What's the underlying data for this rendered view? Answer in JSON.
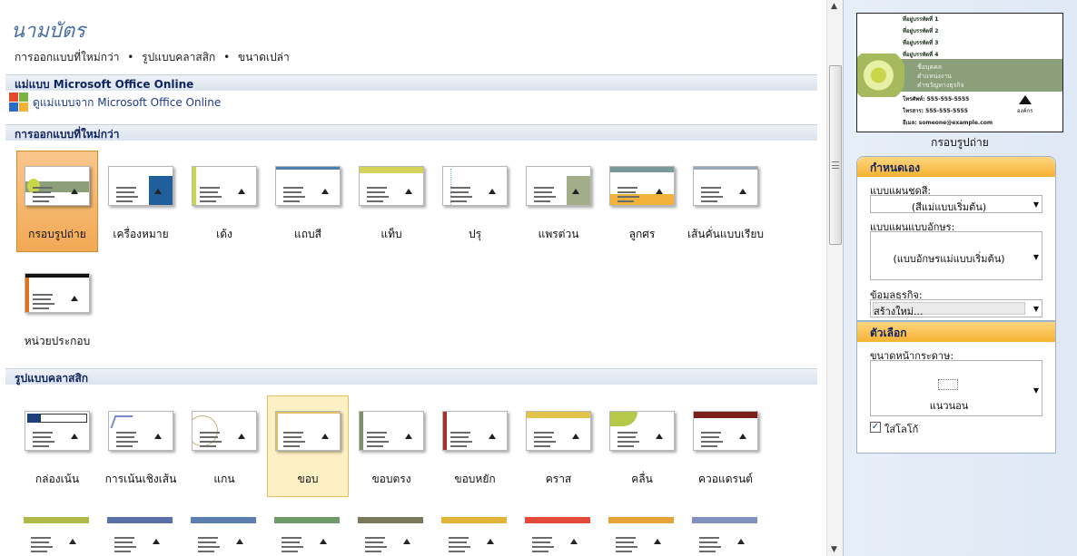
{
  "title": "นามบัตร",
  "breadcrumb": [
    "การออกแบบที่ใหม่กว่า",
    "รูปแบบคลาสสิก",
    "ขนาดเปล่า"
  ],
  "sections": {
    "online_header": "แม่แบบ Microsoft Office Online",
    "online_link": "ดูแม่แบบจาก Microsoft Office Online",
    "newer_header": "การออกแบบที่ใหม่กว่า",
    "classic_header": "รูปแบบคลาสสิก"
  },
  "newer_designs": [
    {
      "label": "กรอบรูปถ่าย",
      "accent": "#8b9f7b",
      "style": "band-mid"
    },
    {
      "label": "เครื่องหมาย",
      "accent": "#1f5f9b",
      "style": "block-right"
    },
    {
      "label": "เด้ง",
      "accent": "#c9d64a",
      "style": "left-bar"
    },
    {
      "label": "แถบสี",
      "accent": "#4d7fb0",
      "style": "top-bar"
    },
    {
      "label": "แท็บ",
      "accent": "#d6d35a",
      "style": "top-band"
    },
    {
      "label": "ปรุ",
      "accent": "#7ab3d3",
      "style": "dotted"
    },
    {
      "label": "แพรต่วน",
      "accent": "#a3ad8a",
      "style": "block-right"
    },
    {
      "label": "ลูกศร",
      "accent": "#f2b13a",
      "style": "bottom-band"
    },
    {
      "label": "เส้นคั่นแบบเรียบ",
      "accent": "#9aa7b8",
      "style": "top-bar"
    },
    {
      "label": "หน่วยประกอบ",
      "accent": "#e0741e",
      "style": "left-bar-top"
    }
  ],
  "classic_designs": [
    {
      "label": "กล่องเน้น",
      "accent": "#1f3f7a",
      "style": "box"
    },
    {
      "label": "การเน้นเชิงเส้น",
      "accent": "#7a86c6",
      "style": "lines"
    },
    {
      "label": "แกน",
      "accent": "#c2b37a",
      "style": "circle"
    },
    {
      "label": "ขอบ",
      "accent": "#e0c067",
      "style": "border"
    },
    {
      "label": "ขอบตรง",
      "accent": "#7a8f6a",
      "style": "left-bar"
    },
    {
      "label": "ขอบหยัก",
      "accent": "#a8302a",
      "style": "left-bar"
    },
    {
      "label": "คราส",
      "accent": "#e3c44a",
      "style": "top-band"
    },
    {
      "label": "คลื่น",
      "accent": "#b6c84a",
      "style": "wave"
    },
    {
      "label": "ควอแดรนต์",
      "accent": "#7a1f1a",
      "style": "top-band"
    }
  ],
  "partial_row_accents": [
    "#b0b84a",
    "#5a70a8",
    "#5a7fb0",
    "#6f9a6a",
    "#7a7a5a",
    "#e3b43a",
    "#e34a3a",
    "#e8a23a",
    "#8090c0"
  ],
  "selected_newer": "กรอบรูปถ่าย",
  "selected_classic": "ขอบ",
  "preview": {
    "lines": [
      "ที่อยู่บรรทัดที่ 1",
      "ที่อยู่บรรทัดที่ 2",
      "ที่อยู่บรรทัดที่ 3",
      "ที่อยู่บรรทัดที่ 4"
    ],
    "name": "ชื่อบุคคล",
    "job": "ตำแหน่งงาน",
    "tagline": "คำขวัญทางธุรกิจ",
    "phone": "โทรศัพท์: 555-555-5555",
    "fax": "โทรสาร: 555-555-5555",
    "email": "อีเมล: someone@example.com",
    "logo_text": "องค์กร",
    "caption": "กรอบรูปถ่าย"
  },
  "customize": {
    "header": "กำหนดเอง",
    "color_scheme_label": "แบบแผนชุดสี:",
    "color_scheme_value": "(สีแม่แบบเริ่มต้น)",
    "font_scheme_label": "แบบแผนแบบอักษร:",
    "font_scheme_value": "(แบบอักษรแม่แบบเริ่มต้น)",
    "business_info_label": "ข้อมูลธุรกิจ:",
    "business_info_value": "สร้างใหม่..."
  },
  "options": {
    "header": "ตัวเลือก",
    "page_size_label": "ขนาดหน้ากระดาษ:",
    "page_size_value": "แนวนอน",
    "logo_checkbox_label": "ใส่โลโก้",
    "logo_checked": true
  }
}
